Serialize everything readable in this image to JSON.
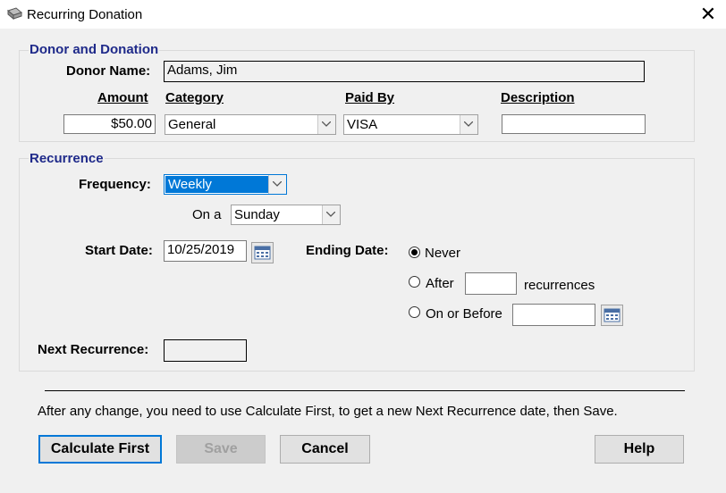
{
  "window": {
    "title": "Recurring Donation",
    "close_icon": "close-icon"
  },
  "donor_section": {
    "title": "Donor and Donation",
    "donor_name_label": "Donor Name:",
    "donor_name_value": "Adams, Jim",
    "amount_header": "Amount",
    "category_header": "Category",
    "paid_by_header": "Paid By",
    "description_header": "Description",
    "amount_value": "$50.00",
    "category_value": "General",
    "paid_by_value": "VISA",
    "description_value": ""
  },
  "recurrence_section": {
    "title": "Recurrence",
    "frequency_label": "Frequency:",
    "frequency_value": "Weekly",
    "on_a_label": "On a",
    "on_a_value": "Sunday",
    "start_date_label": "Start Date:",
    "start_date_value": "10/25/2019",
    "ending_date_label": "Ending Date:",
    "never_label": "Never",
    "after_label": "After",
    "after_value": "",
    "recurrences_label": "recurrences",
    "on_or_before_label": "On or Before",
    "on_or_before_value": "",
    "ending_selected": "Never",
    "next_recurrence_label": "Next Recurrence:",
    "next_recurrence_value": ""
  },
  "info_text": "After any change, you need to use Calculate First, to get a new Next Recurrence date, then Save.",
  "buttons": {
    "calculate_first": "Calculate First",
    "save": "Save",
    "cancel": "Cancel",
    "help": "Help"
  },
  "colors": {
    "section_title": "#1f2a8a",
    "selection": "#0078d7",
    "focus_border": "#0078d7"
  }
}
